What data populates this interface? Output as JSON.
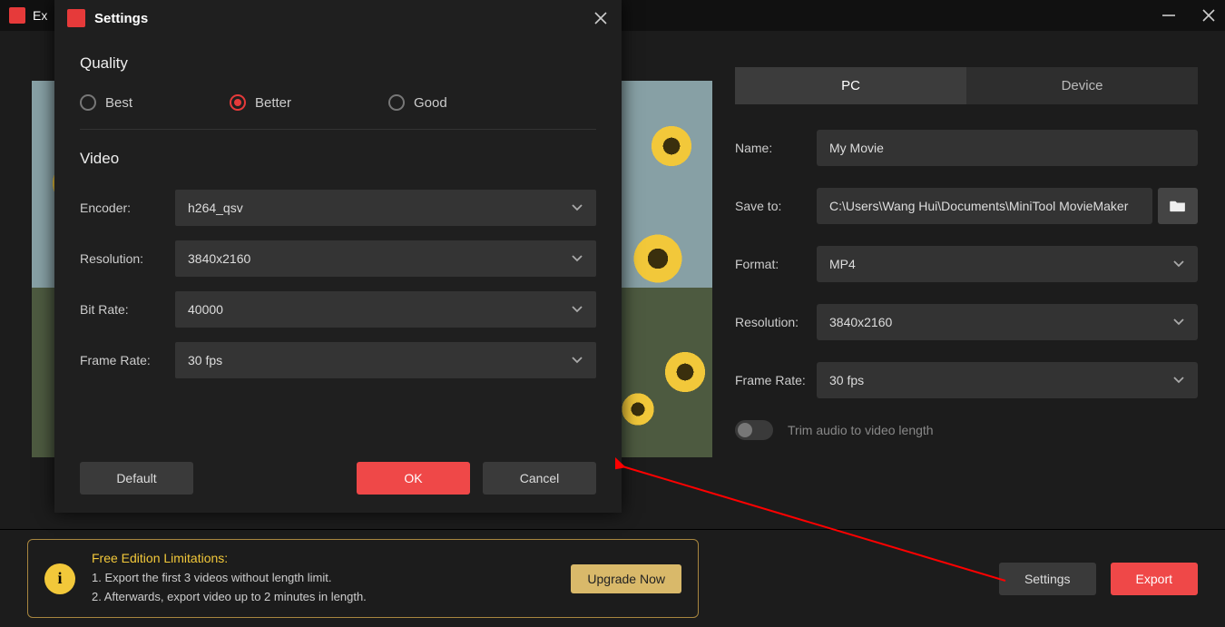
{
  "titlebar": {
    "title": "Ex"
  },
  "rightPanel": {
    "tabs": {
      "pc": "PC",
      "device": "Device"
    },
    "name_label": "Name:",
    "name_value": "My Movie",
    "saveto_label": "Save to:",
    "saveto_value": "C:\\Users\\Wang Hui\\Documents\\MiniTool MovieMaker",
    "format_label": "Format:",
    "format_value": "MP4",
    "resolution_label": "Resolution:",
    "resolution_value": "3840x2160",
    "framerate_label": "Frame Rate:",
    "framerate_value": "30 fps",
    "trim_label": "Trim audio to video length"
  },
  "footer": {
    "limit_header": "Free Edition Limitations:",
    "limit_line1": "1. Export the first 3 videos without length limit.",
    "limit_line2": "2. Afterwards, export video up to 2 minutes in length.",
    "upgrade": "Upgrade Now",
    "settings": "Settings",
    "export": "Export"
  },
  "modal": {
    "title": "Settings",
    "quality_header": "Quality",
    "radios": {
      "best": "Best",
      "better": "Better",
      "good": "Good"
    },
    "video_header": "Video",
    "encoder_label": "Encoder:",
    "encoder_value": "h264_qsv",
    "resolution_label": "Resolution:",
    "resolution_value": "3840x2160",
    "bitrate_label": "Bit Rate:",
    "bitrate_value": "40000",
    "framerate_label": "Frame Rate:",
    "framerate_value": "30 fps",
    "default_btn": "Default",
    "ok_btn": "OK",
    "cancel_btn": "Cancel"
  }
}
